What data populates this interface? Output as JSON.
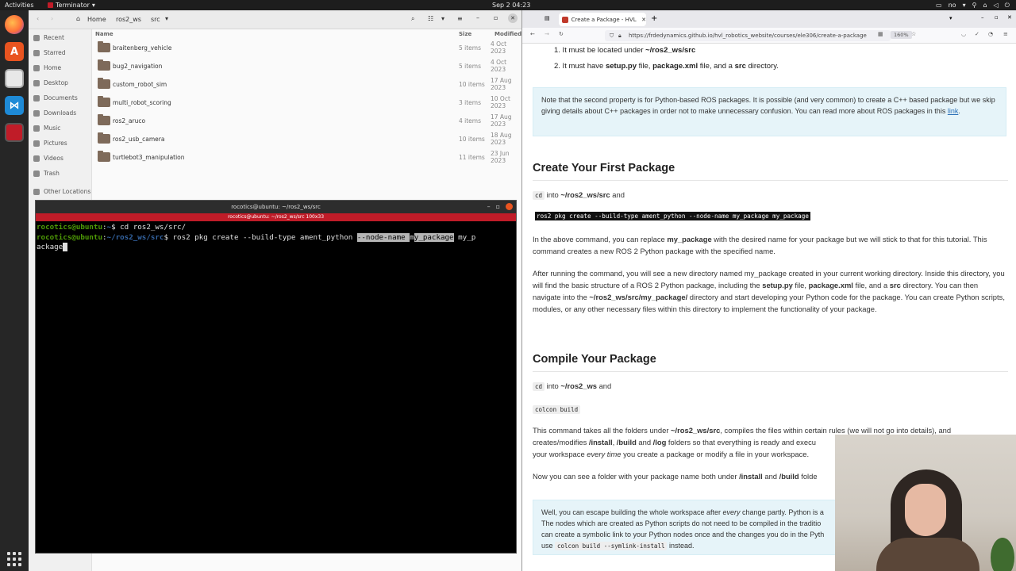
{
  "topbar": {
    "activities": "Activities",
    "app_name": "Terminator",
    "clock": "Sep 2  04:23",
    "lang": "no"
  },
  "dock": {
    "apps": [
      "firefox-icon",
      "app-center-icon",
      "files-icon",
      "vscode-icon",
      "terminator-icon"
    ]
  },
  "files": {
    "path": [
      "Home",
      "ros2_ws",
      "src"
    ],
    "columns": {
      "name": "Name",
      "size": "Size",
      "modified": "Modified"
    },
    "sidebar": [
      "Recent",
      "Starred",
      "Home",
      "Desktop",
      "Documents",
      "Downloads",
      "Music",
      "Pictures",
      "Videos",
      "Trash",
      "Other Locations"
    ],
    "rows": [
      {
        "name": "braitenberg_vehicle",
        "size": "5 items",
        "modified": "4 Oct 2023"
      },
      {
        "name": "bug2_navigation",
        "size": "5 items",
        "modified": "4 Oct 2023"
      },
      {
        "name": "custom_robot_sim",
        "size": "10 items",
        "modified": "17 Aug 2023"
      },
      {
        "name": "multi_robot_scoring",
        "size": "3 items",
        "modified": "10 Oct 2023"
      },
      {
        "name": "ros2_aruco",
        "size": "4 items",
        "modified": "17 Aug 2023"
      },
      {
        "name": "ros2_usb_camera",
        "size": "10 items",
        "modified": "18 Aug 2023"
      },
      {
        "name": "turtlebot3_manipulation",
        "size": "11 items",
        "modified": "23 Jun 2023"
      }
    ]
  },
  "terminal": {
    "title": "rocotics@ubuntu: ~/ros2_ws/src",
    "tab_title": "rocotics@ubuntu: ~/ros2_ws/src 100x33",
    "line1_prompt_user": "rocotics@ubuntu",
    "line1_prompt_path": "~",
    "line1_cmd": "$ cd ros2_ws/src/",
    "line2_prompt_user": "rocotics@ubuntu",
    "line2_prompt_path": "~/ros2_ws/src",
    "line2_cmd_a": "$ ros2 pkg create --build-type ament_python ",
    "line2_sel_a": "--node-name ",
    "line2_cursor_char": "m",
    "line2_sel_b": "y_package",
    "line2_tail": " my_p",
    "line3": "ackage"
  },
  "browser": {
    "tab_title": "Create a Package - HVL Robo",
    "url": "https://frdedynamics.github.io/hvl_robotics_website/courses/ele306/create-a-package",
    "zoom": "160%",
    "list_item_1_pre": "1.  It must be located under ",
    "list_item_1_bold": "~/ros2_ws/src",
    "list_item_2_pre": "2.  It must have ",
    "list_item_2_b1": "setup.py",
    "list_item_2_m1": " file, ",
    "list_item_2_b2": "package.xml",
    "list_item_2_m2": " file, and a ",
    "list_item_2_b3": "src",
    "list_item_2_end": " directory.",
    "note1": "Note that the second property is for Python-based ROS packages. It is possible (and very common) to create a C++ based package but we skip giving details about C++ packages in order not to make unnecessary confusion. You can read more about ROS packages in this ",
    "note1_link": "link",
    "note1_end": ".",
    "h_create": "Create Your First Package",
    "cd_code": "cd",
    "cd_into": " into ",
    "cd_path": "~/ros2_ws/src",
    "cd_and": " and",
    "create_cmd": "ros2 pkg create --build-type ament_python --node-name my_package my_package",
    "p1_a": "In the above command, you can replace ",
    "p1_b": "my_package",
    "p1_c": " with the desired name for your package but we will stick to that for this tutorial. This command creates a new ROS 2 Python package with the specified name.",
    "p2_a": "After running the command, you will see a new directory named my_package created in your current working directory. Inside this directory, you will find the basic structure of a ROS 2 Python package, including the ",
    "p2_b": "setup.py",
    "p2_c": " file, ",
    "p2_d": "package.xml",
    "p2_e": " file, and a ",
    "p2_f": "src",
    "p2_g": " directory. You can then navigate into the ",
    "p2_h": "~/ros2_ws/src/my_package/",
    "p2_i": " directory and start developing your Python code for the package. You can create Python scripts, modules, or any other necessary files within this directory to implement the functionality of your package.",
    "h_compile": "Compile Your Package",
    "cd2_path": "~/ros2_ws",
    "colcon": "colcon build",
    "p3_a": "This command takes all the folders under ",
    "p3_b": "~/ros2_ws/src",
    "p3_c": ", compiles the files within certain rules (we will not go into details), and creates/modifies ",
    "p3_d": "/install",
    "p3_e": ", ",
    "p3_f": "/build",
    "p3_g": " and ",
    "p3_h": "/log",
    "p3_i": " folders so that everything is ready and execu",
    "p3_j": "your workspace ",
    "p3_k": "every time",
    "p3_l": " you create a package or modify a file in your workspace.",
    "p4_a": "Now you can see a folder with your package name both under ",
    "p4_b": "/install",
    "p4_c": " and ",
    "p4_d": "/build",
    "p4_e": " folde",
    "note2_a": "Well, you can escape building the whole workspace after ",
    "note2_b": "every",
    "note2_c": " change partly. Python is a",
    "note2_d": "The nodes which are created as Python scripts do not need to be compiled in the traditio",
    "note2_e": "can create a symbolic link to your Python nodes once and the changes you do in the Pyth",
    "note2_f": "use ",
    "note2_code": "colcon build --symlink-install",
    "note2_g": " instead."
  }
}
